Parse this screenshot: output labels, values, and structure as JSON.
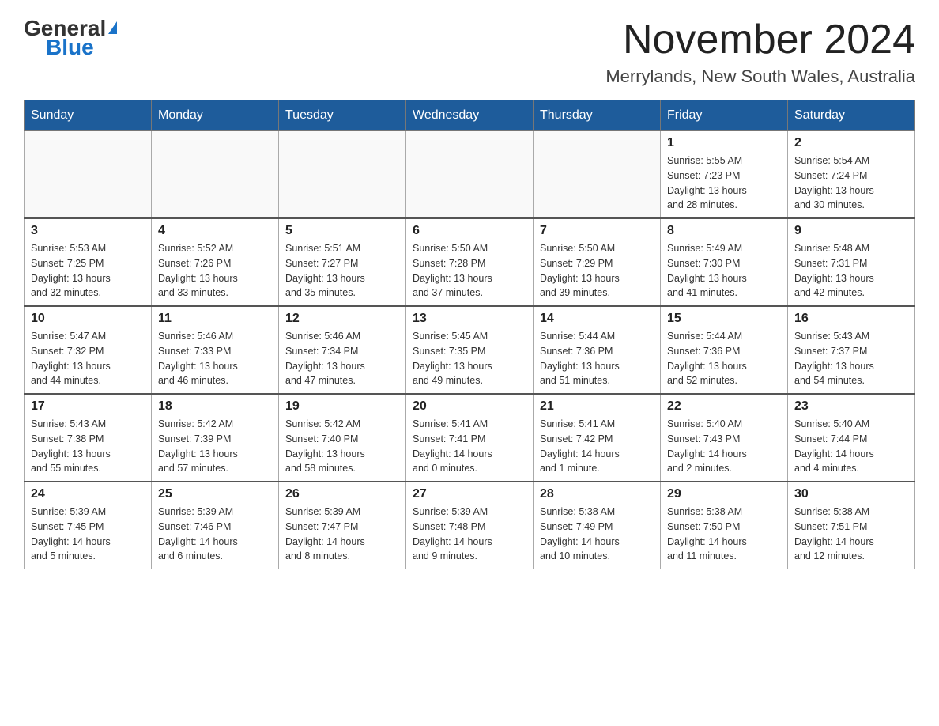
{
  "header": {
    "logo": {
      "general": "General",
      "triangle": "▶",
      "blue": "Blue"
    },
    "title": "November 2024",
    "location": "Merrylands, New South Wales, Australia"
  },
  "days_of_week": [
    "Sunday",
    "Monday",
    "Tuesday",
    "Wednesday",
    "Thursday",
    "Friday",
    "Saturday"
  ],
  "weeks": [
    [
      {
        "day": "",
        "info": ""
      },
      {
        "day": "",
        "info": ""
      },
      {
        "day": "",
        "info": ""
      },
      {
        "day": "",
        "info": ""
      },
      {
        "day": "",
        "info": ""
      },
      {
        "day": "1",
        "info": "Sunrise: 5:55 AM\nSunset: 7:23 PM\nDaylight: 13 hours\nand 28 minutes."
      },
      {
        "day": "2",
        "info": "Sunrise: 5:54 AM\nSunset: 7:24 PM\nDaylight: 13 hours\nand 30 minutes."
      }
    ],
    [
      {
        "day": "3",
        "info": "Sunrise: 5:53 AM\nSunset: 7:25 PM\nDaylight: 13 hours\nand 32 minutes."
      },
      {
        "day": "4",
        "info": "Sunrise: 5:52 AM\nSunset: 7:26 PM\nDaylight: 13 hours\nand 33 minutes."
      },
      {
        "day": "5",
        "info": "Sunrise: 5:51 AM\nSunset: 7:27 PM\nDaylight: 13 hours\nand 35 minutes."
      },
      {
        "day": "6",
        "info": "Sunrise: 5:50 AM\nSunset: 7:28 PM\nDaylight: 13 hours\nand 37 minutes."
      },
      {
        "day": "7",
        "info": "Sunrise: 5:50 AM\nSunset: 7:29 PM\nDaylight: 13 hours\nand 39 minutes."
      },
      {
        "day": "8",
        "info": "Sunrise: 5:49 AM\nSunset: 7:30 PM\nDaylight: 13 hours\nand 41 minutes."
      },
      {
        "day": "9",
        "info": "Sunrise: 5:48 AM\nSunset: 7:31 PM\nDaylight: 13 hours\nand 42 minutes."
      }
    ],
    [
      {
        "day": "10",
        "info": "Sunrise: 5:47 AM\nSunset: 7:32 PM\nDaylight: 13 hours\nand 44 minutes."
      },
      {
        "day": "11",
        "info": "Sunrise: 5:46 AM\nSunset: 7:33 PM\nDaylight: 13 hours\nand 46 minutes."
      },
      {
        "day": "12",
        "info": "Sunrise: 5:46 AM\nSunset: 7:34 PM\nDaylight: 13 hours\nand 47 minutes."
      },
      {
        "day": "13",
        "info": "Sunrise: 5:45 AM\nSunset: 7:35 PM\nDaylight: 13 hours\nand 49 minutes."
      },
      {
        "day": "14",
        "info": "Sunrise: 5:44 AM\nSunset: 7:36 PM\nDaylight: 13 hours\nand 51 minutes."
      },
      {
        "day": "15",
        "info": "Sunrise: 5:44 AM\nSunset: 7:36 PM\nDaylight: 13 hours\nand 52 minutes."
      },
      {
        "day": "16",
        "info": "Sunrise: 5:43 AM\nSunset: 7:37 PM\nDaylight: 13 hours\nand 54 minutes."
      }
    ],
    [
      {
        "day": "17",
        "info": "Sunrise: 5:43 AM\nSunset: 7:38 PM\nDaylight: 13 hours\nand 55 minutes."
      },
      {
        "day": "18",
        "info": "Sunrise: 5:42 AM\nSunset: 7:39 PM\nDaylight: 13 hours\nand 57 minutes."
      },
      {
        "day": "19",
        "info": "Sunrise: 5:42 AM\nSunset: 7:40 PM\nDaylight: 13 hours\nand 58 minutes."
      },
      {
        "day": "20",
        "info": "Sunrise: 5:41 AM\nSunset: 7:41 PM\nDaylight: 14 hours\nand 0 minutes."
      },
      {
        "day": "21",
        "info": "Sunrise: 5:41 AM\nSunset: 7:42 PM\nDaylight: 14 hours\nand 1 minute."
      },
      {
        "day": "22",
        "info": "Sunrise: 5:40 AM\nSunset: 7:43 PM\nDaylight: 14 hours\nand 2 minutes."
      },
      {
        "day": "23",
        "info": "Sunrise: 5:40 AM\nSunset: 7:44 PM\nDaylight: 14 hours\nand 4 minutes."
      }
    ],
    [
      {
        "day": "24",
        "info": "Sunrise: 5:39 AM\nSunset: 7:45 PM\nDaylight: 14 hours\nand 5 minutes."
      },
      {
        "day": "25",
        "info": "Sunrise: 5:39 AM\nSunset: 7:46 PM\nDaylight: 14 hours\nand 6 minutes."
      },
      {
        "day": "26",
        "info": "Sunrise: 5:39 AM\nSunset: 7:47 PM\nDaylight: 14 hours\nand 8 minutes."
      },
      {
        "day": "27",
        "info": "Sunrise: 5:39 AM\nSunset: 7:48 PM\nDaylight: 14 hours\nand 9 minutes."
      },
      {
        "day": "28",
        "info": "Sunrise: 5:38 AM\nSunset: 7:49 PM\nDaylight: 14 hours\nand 10 minutes."
      },
      {
        "day": "29",
        "info": "Sunrise: 5:38 AM\nSunset: 7:50 PM\nDaylight: 14 hours\nand 11 minutes."
      },
      {
        "day": "30",
        "info": "Sunrise: 5:38 AM\nSunset: 7:51 PM\nDaylight: 14 hours\nand 12 minutes."
      }
    ]
  ]
}
